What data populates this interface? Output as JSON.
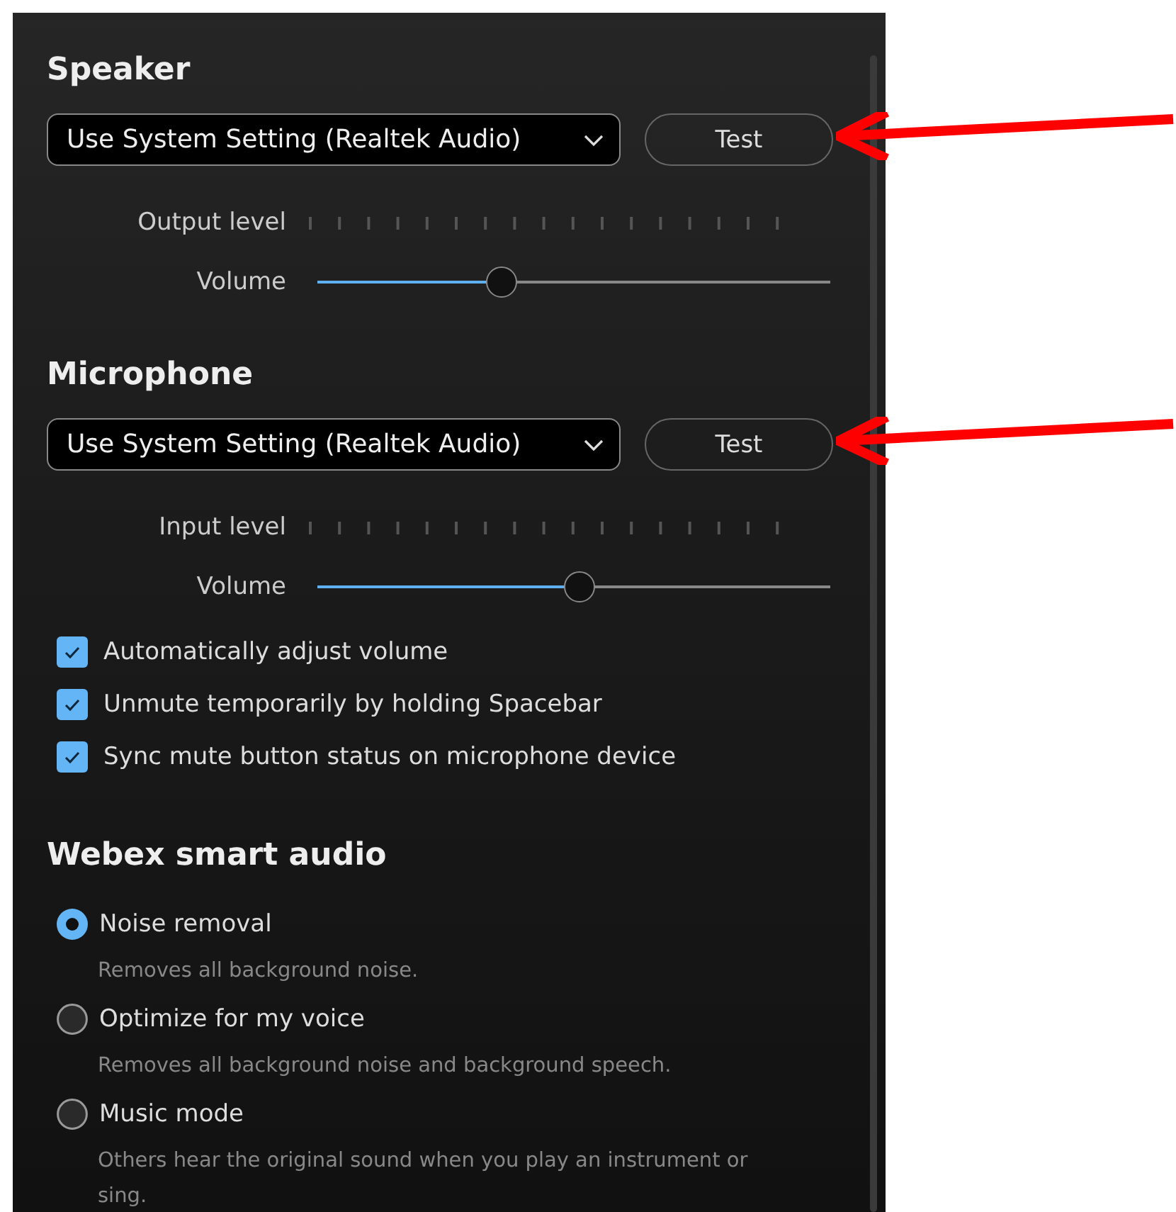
{
  "sections": [
    {
      "kind": "device",
      "title": "Speaker",
      "device": "Use System Setting (Realtek Audio)",
      "test_button": "Test",
      "level_label": "Output level",
      "volume_label": "Volume",
      "volume": {
        "level": 0.36
      }
    },
    {
      "kind": "device",
      "title": "Microphone",
      "device": "Use System Setting (Realtek Audio)",
      "test_button": "Test",
      "level_label": "Input level",
      "volume_label": "Volume",
      "volume": {
        "level": 0.51
      }
    }
  ],
  "options": [
    {
      "label": "Automatically adjust volume",
      "checked": true
    },
    {
      "label": "Unmute temporarily by holding Spacebar",
      "checked": true
    },
    {
      "label": "Sync mute button status on microphone device",
      "checked": true
    }
  ],
  "smart_audio": {
    "title": "Webex smart audio",
    "modes": [
      {
        "label": "Noise removal",
        "description": "Removes all background noise.",
        "selected": true
      },
      {
        "label": "Optimize for my voice",
        "description": "Removes all background noise and background speech.",
        "selected": false
      },
      {
        "label": "Music mode",
        "description": "Others hear the original sound when you play an instrument or sing.",
        "selected": false
      }
    ]
  }
}
